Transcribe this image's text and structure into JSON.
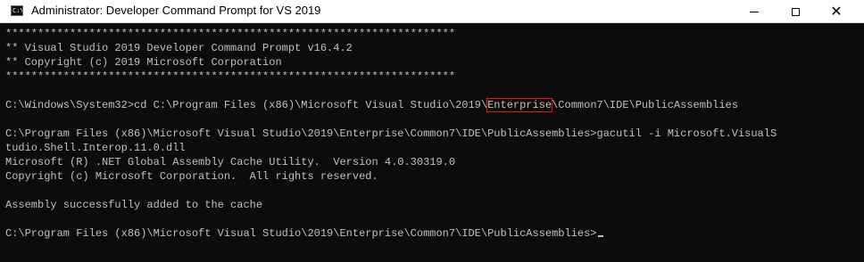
{
  "window": {
    "title": "Administrator: Developer Command Prompt for VS 2019",
    "app_icon_text": "C:\\",
    "controls": {
      "minimize": "minimize-icon",
      "maximize": "maximize-icon",
      "close": "close-icon"
    }
  },
  "console": {
    "stars": "**********************************************************************",
    "banner1": "** Visual Studio 2019 Developer Command Prompt v16.4.2",
    "banner2": "** Copyright (c) 2019 Microsoft Corporation",
    "cmd1_prefix": "C:\\Windows\\System32>cd C:\\Program Files (x86)\\Microsoft Visual Studio\\2019\\",
    "cmd1_highlight": "Enterprise",
    "cmd1_suffix": "\\Common7\\IDE\\PublicAssemblies",
    "cmd2_line1": "C:\\Program Files (x86)\\Microsoft Visual Studio\\2019\\Enterprise\\Common7\\IDE\\PublicAssemblies>gacutil -i Microsoft.VisualS",
    "cmd2_line2": "tudio.Shell.Interop.11.0.dll",
    "out1": "Microsoft (R) .NET Global Assembly Cache Utility.  Version 4.0.30319.0",
    "out2": "Copyright (c) Microsoft Corporation.  All rights reserved.",
    "out3": "Assembly successfully added to the cache",
    "prompt": "C:\\Program Files (x86)\\Microsoft Visual Studio\\2019\\Enterprise\\Common7\\IDE\\PublicAssemblies>"
  },
  "colors": {
    "console_bg": "#0c0c0c",
    "console_fg": "#c0c0c0",
    "highlight_box": "#e81123",
    "titlebar_bg": "#ffffff"
  }
}
